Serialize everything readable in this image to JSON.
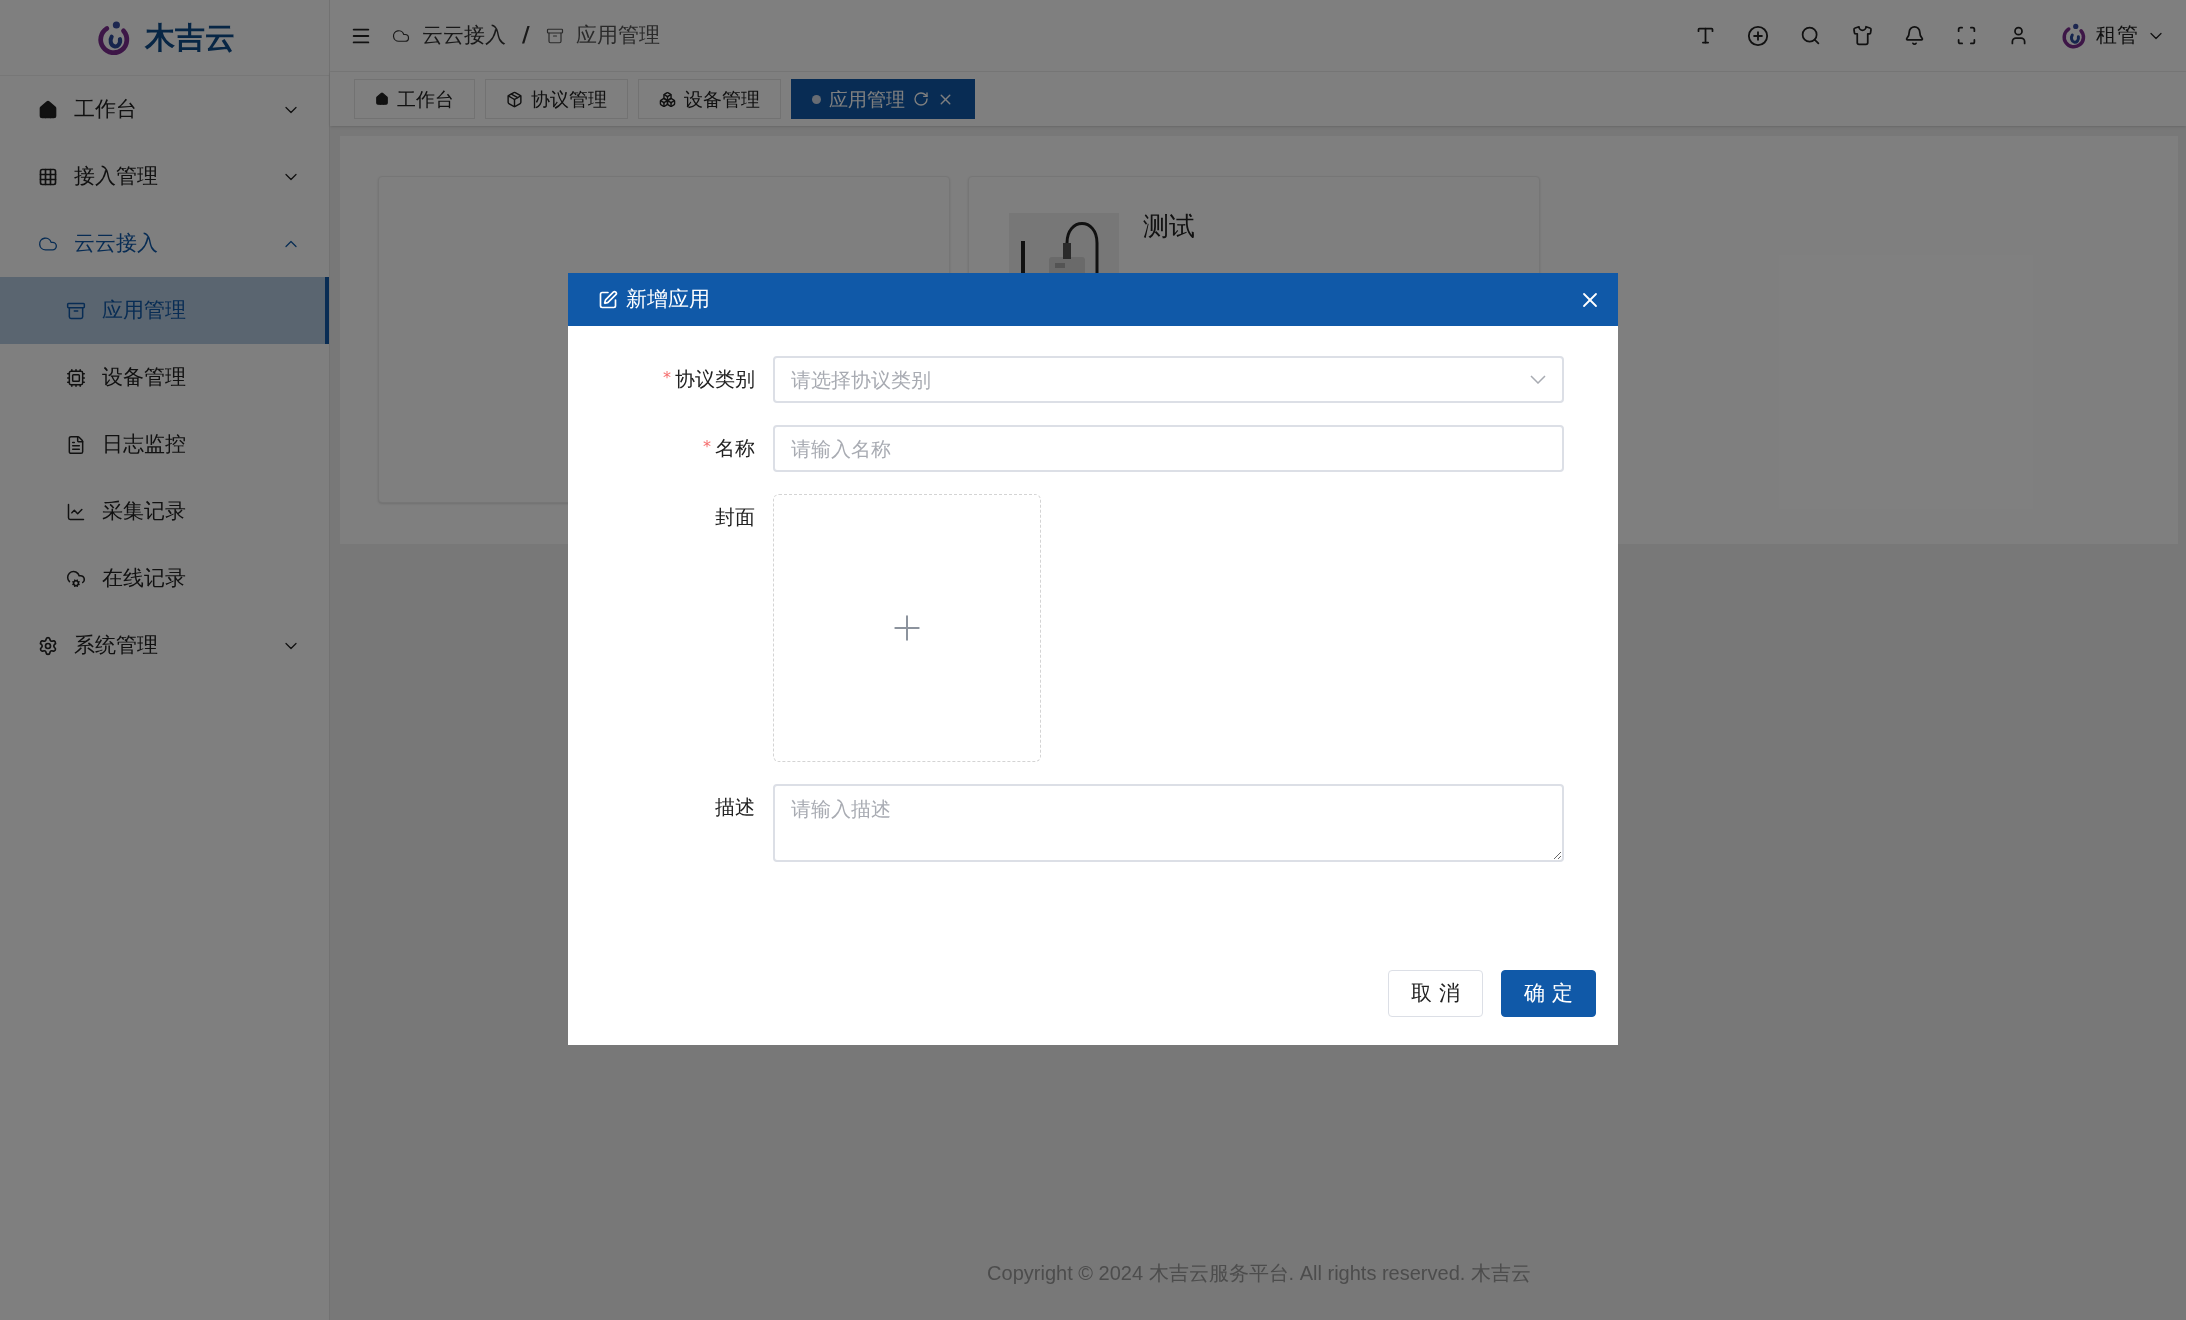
{
  "logo": {
    "text": "木吉云"
  },
  "sidebar": {
    "items": [
      {
        "label": "工作台",
        "selected": false,
        "expanded": false
      },
      {
        "label": "接入管理",
        "selected": false,
        "expanded": false
      },
      {
        "label": "云云接入",
        "selected": true,
        "expanded": true,
        "children": [
          {
            "label": "应用管理",
            "selected": true
          },
          {
            "label": "设备管理",
            "selected": false
          },
          {
            "label": "日志监控",
            "selected": false
          },
          {
            "label": "采集记录",
            "selected": false
          },
          {
            "label": "在线记录",
            "selected": false
          }
        ]
      },
      {
        "label": "系统管理",
        "selected": false,
        "expanded": false
      }
    ]
  },
  "header": {
    "breadcrumb": [
      "云云接入",
      "应用管理"
    ],
    "separator": "/",
    "user": "租管"
  },
  "tabs": [
    {
      "label": "工作台",
      "selected": false
    },
    {
      "label": "协议管理",
      "selected": false
    },
    {
      "label": "设备管理",
      "selected": false
    },
    {
      "label": "应用管理",
      "selected": true
    }
  ],
  "cards": [
    {
      "kind": "empty"
    },
    {
      "kind": "device",
      "title": "测试"
    }
  ],
  "modal": {
    "title": "新增应用",
    "fields": [
      {
        "kind": "select",
        "label": "协议类别",
        "required_mark": "*",
        "placeholder": "请选择协议类别"
      },
      {
        "kind": "input",
        "label": "名称",
        "required_mark": "*",
        "placeholder": "请输入名称"
      },
      {
        "kind": "upload",
        "label": "封面"
      },
      {
        "kind": "textarea",
        "label": "描述",
        "placeholder": "请输入描述"
      }
    ],
    "buttons": [
      {
        "label": "取 消",
        "primary": false
      },
      {
        "label": "确 定",
        "primary": true
      }
    ]
  },
  "footer": "Copyright © 2024 木吉云服务平台. All rights reserved. 木吉云"
}
